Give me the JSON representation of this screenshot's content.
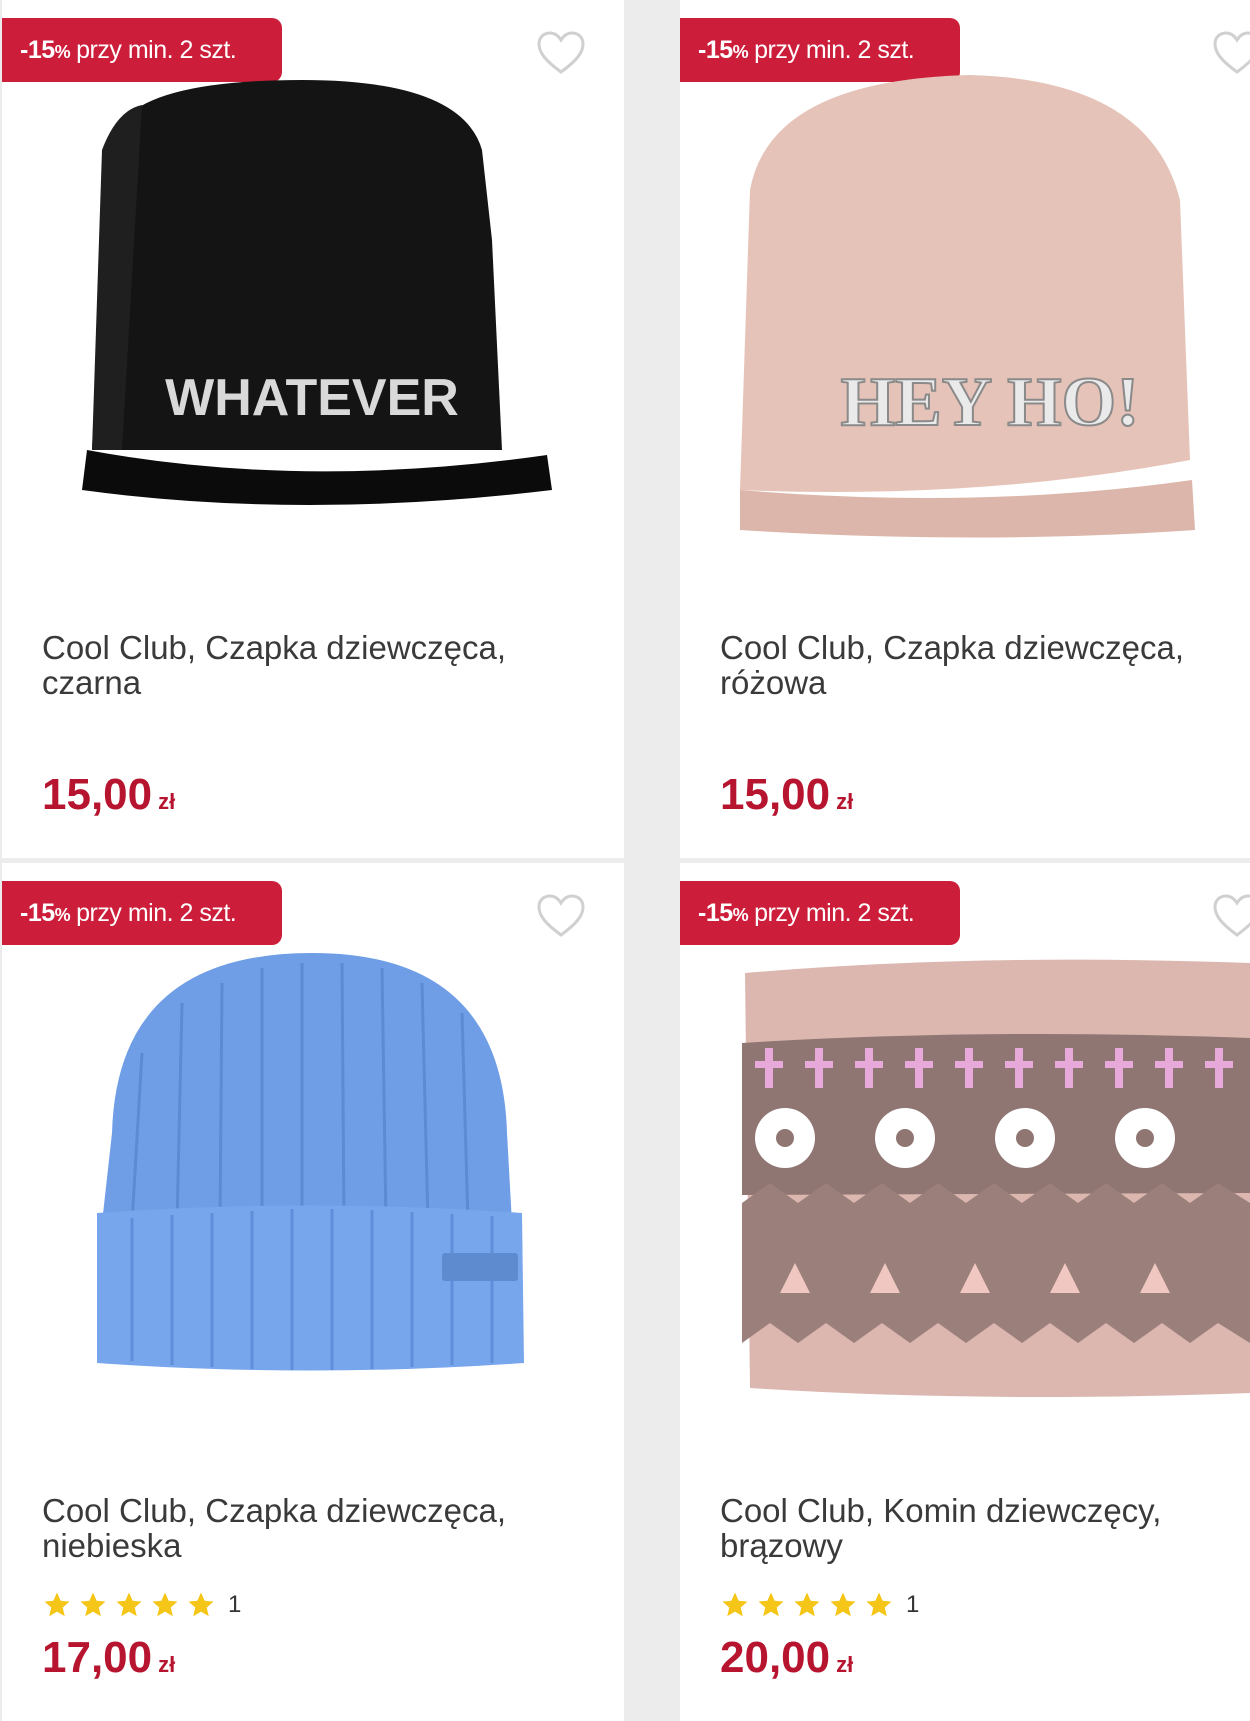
{
  "products": [
    {
      "badge_pct": "-15",
      "badge_pct_sign": "%",
      "badge_text": "przy min. 2 szt.",
      "title": "Cool Club, Czapka dziewczęca, czarna",
      "price": "15,00",
      "currency": "zł",
      "image_text": "WHATEVER",
      "image_color": "#121212"
    },
    {
      "badge_pct": "-15",
      "badge_pct_sign": "%",
      "badge_text": "przy min. 2 szt.",
      "title": "Cool Club, Czapka dziewczęca, różowa",
      "price": "15,00",
      "currency": "zł",
      "image_text": "HEY HO!",
      "image_color": "#e6c3b8"
    },
    {
      "badge_pct": "-15",
      "badge_pct_sign": "%",
      "badge_text": "przy min. 2 szt.",
      "title": "Cool Club, Czapka dziewczęca, niebieska",
      "rating": 5,
      "reviews": "1",
      "price": "17,00",
      "currency": "zł",
      "image_color": "#6f9ee6"
    },
    {
      "badge_pct": "-15",
      "badge_pct_sign": "%",
      "badge_text": "przy min. 2 szt.",
      "title": "Cool Club, Komin dziewczęcy, brązowy",
      "rating": 5,
      "reviews": "1",
      "price": "20,00",
      "currency": "zł",
      "image_color": "#dbb7b0"
    }
  ],
  "colors": {
    "badge": "#cc1e3a",
    "price": "#b7142f",
    "star": "#f5c518"
  }
}
